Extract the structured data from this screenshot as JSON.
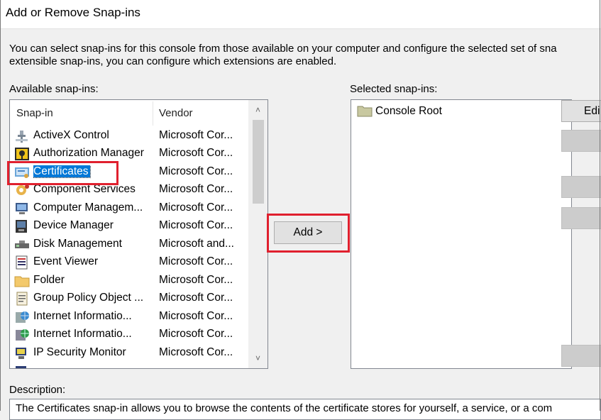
{
  "window": {
    "title": "Add or Remove Snap-ins"
  },
  "intro": {
    "line1": "You can select snap-ins for this console from those available on your computer and configure the selected set of sna",
    "line2": "extensible snap-ins, you can configure which extensions are enabled."
  },
  "available": {
    "label": "Available snap-ins:",
    "columns": {
      "snapin": "Snap-in",
      "vendor": "Vendor"
    },
    "items": [
      {
        "name": "ActiveX Control",
        "vendor": "Microsoft Cor...",
        "icon": "activex-icon"
      },
      {
        "name": "Authorization Manager",
        "vendor": "Microsoft Cor...",
        "icon": "authorization-icon"
      },
      {
        "name": "Certificates",
        "vendor": "Microsoft Cor...",
        "icon": "certificates-icon",
        "selected": true
      },
      {
        "name": "Component Services",
        "vendor": "Microsoft Cor...",
        "icon": "component-services-icon"
      },
      {
        "name": "Computer Managem...",
        "vendor": "Microsoft Cor...",
        "icon": "computer-management-icon"
      },
      {
        "name": "Device Manager",
        "vendor": "Microsoft Cor...",
        "icon": "device-manager-icon"
      },
      {
        "name": "Disk Management",
        "vendor": "Microsoft and...",
        "icon": "disk-management-icon"
      },
      {
        "name": "Event Viewer",
        "vendor": "Microsoft Cor...",
        "icon": "event-viewer-icon"
      },
      {
        "name": "Folder",
        "vendor": "Microsoft Cor...",
        "icon": "folder-icon"
      },
      {
        "name": "Group Policy Object ...",
        "vendor": "Microsoft Cor...",
        "icon": "group-policy-icon"
      },
      {
        "name": "Internet Informatio...",
        "vendor": "Microsoft Cor...",
        "icon": "iis-icon"
      },
      {
        "name": "Internet Informatio...",
        "vendor": "Microsoft Cor...",
        "icon": "iis6-icon"
      },
      {
        "name": "IP Security Monitor",
        "vendor": "Microsoft Cor...",
        "icon": "ip-security-monitor-icon"
      }
    ]
  },
  "add_button": {
    "label": "Add >"
  },
  "selected": {
    "label": "Selected snap-ins:",
    "items": [
      {
        "name": "Console Root",
        "icon": "console-root-folder-icon"
      }
    ]
  },
  "right_buttons": [
    {
      "label": "Edi"
    }
  ],
  "description": {
    "label": "Description:",
    "text": "The Certificates snap-in allows you to browse the contents of the certificate stores for yourself, a service, or a com"
  },
  "colors": {
    "selection": "#0078d7",
    "highlight_annotation": "#e0202e"
  }
}
